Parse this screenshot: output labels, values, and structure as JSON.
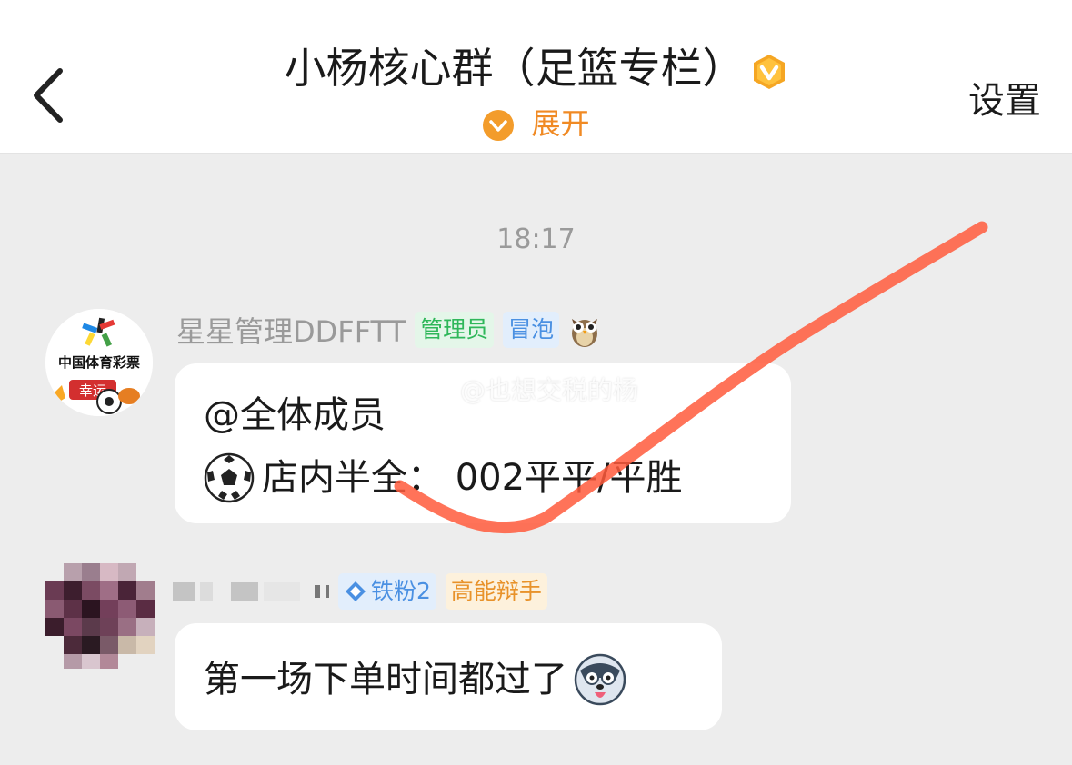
{
  "header": {
    "title": "小杨核心群（足篮专栏）",
    "expand_label": "展开",
    "settings_label": "设置"
  },
  "chat": {
    "timestamp": "18:17",
    "messages": [
      {
        "sender": "星星管理DDFFTT",
        "avatar_text": "中国体育彩票",
        "avatar_badge": "幸运",
        "tags": [
          "管理员",
          "冒泡"
        ],
        "lines": [
          "@全体成员",
          "店内半全：  002平平/平胜"
        ]
      },
      {
        "sender": "",
        "tags": [
          "铁粉2",
          "高能辩手"
        ],
        "lines": [
          "第一场下单时间都过了"
        ]
      }
    ]
  },
  "watermark": "@也想交税的杨",
  "colors": {
    "accent": "#f08a24",
    "admin_tag": "#2fb75a",
    "blue_tag": "#4a90e2",
    "scribble": "#ff5a3c"
  }
}
